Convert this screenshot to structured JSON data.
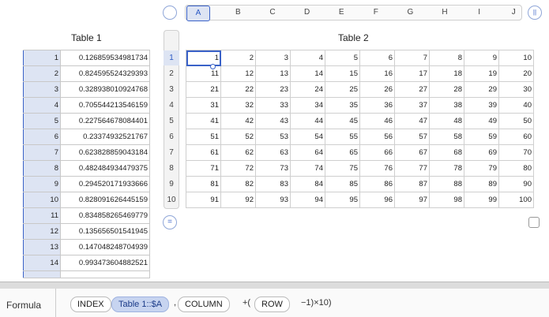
{
  "table1": {
    "title": "Table 1",
    "rows": [
      {
        "n": "1",
        "v": "0.126859534981734"
      },
      {
        "n": "2",
        "v": "0.824595524329393"
      },
      {
        "n": "3",
        "v": "0.328938010924768"
      },
      {
        "n": "4",
        "v": "0.705544213546159"
      },
      {
        "n": "5",
        "v": "0.227564678084401"
      },
      {
        "n": "6",
        "v": "0.23374932521767"
      },
      {
        "n": "7",
        "v": "0.623828859043184"
      },
      {
        "n": "8",
        "v": "0.482484934479375"
      },
      {
        "n": "9",
        "v": "0.294520171933666"
      },
      {
        "n": "10",
        "v": "0.828091626445159"
      },
      {
        "n": "11",
        "v": "0.834858265469779"
      },
      {
        "n": "12",
        "v": "0.135656501541945"
      },
      {
        "n": "13",
        "v": "0.147048248704939"
      },
      {
        "n": "14",
        "v": "0.993473604882521"
      }
    ]
  },
  "table2": {
    "title": "Table 2",
    "columns": [
      "A",
      "B",
      "C",
      "D",
      "E",
      "F",
      "G",
      "H",
      "I",
      "J"
    ],
    "row_numbers": [
      "1",
      "2",
      "3",
      "4",
      "5",
      "6",
      "7",
      "8",
      "9",
      "10"
    ],
    "rows": [
      [
        "1",
        "2",
        "3",
        "4",
        "5",
        "6",
        "7",
        "8",
        "9",
        "10"
      ],
      [
        "11",
        "12",
        "13",
        "14",
        "15",
        "16",
        "17",
        "18",
        "19",
        "20"
      ],
      [
        "21",
        "22",
        "23",
        "24",
        "25",
        "26",
        "27",
        "28",
        "29",
        "30"
      ],
      [
        "31",
        "32",
        "33",
        "34",
        "35",
        "36",
        "37",
        "38",
        "39",
        "40"
      ],
      [
        "41",
        "42",
        "43",
        "44",
        "45",
        "46",
        "47",
        "48",
        "49",
        "50"
      ],
      [
        "51",
        "52",
        "53",
        "54",
        "55",
        "56",
        "57",
        "58",
        "59",
        "60"
      ],
      [
        "61",
        "62",
        "63",
        "64",
        "65",
        "66",
        "67",
        "68",
        "69",
        "70"
      ],
      [
        "71",
        "72",
        "73",
        "74",
        "75",
        "76",
        "77",
        "78",
        "79",
        "80"
      ],
      [
        "81",
        "82",
        "83",
        "84",
        "85",
        "86",
        "87",
        "88",
        "89",
        "90"
      ],
      [
        "91",
        "92",
        "93",
        "94",
        "95",
        "96",
        "97",
        "98",
        "99",
        "100"
      ]
    ]
  },
  "formula": {
    "label": "Formula",
    "index": "INDEX",
    "ref": "Table 1::$A",
    "comma": ",",
    "column": "COLUMN",
    "plus_open": "+(",
    "row": "ROW",
    "tail": "−1)×10)"
  },
  "colors": {
    "accent": "#3a62c8",
    "header_fill": "#dde4f3",
    "ref_token": "#c7d4f0"
  }
}
